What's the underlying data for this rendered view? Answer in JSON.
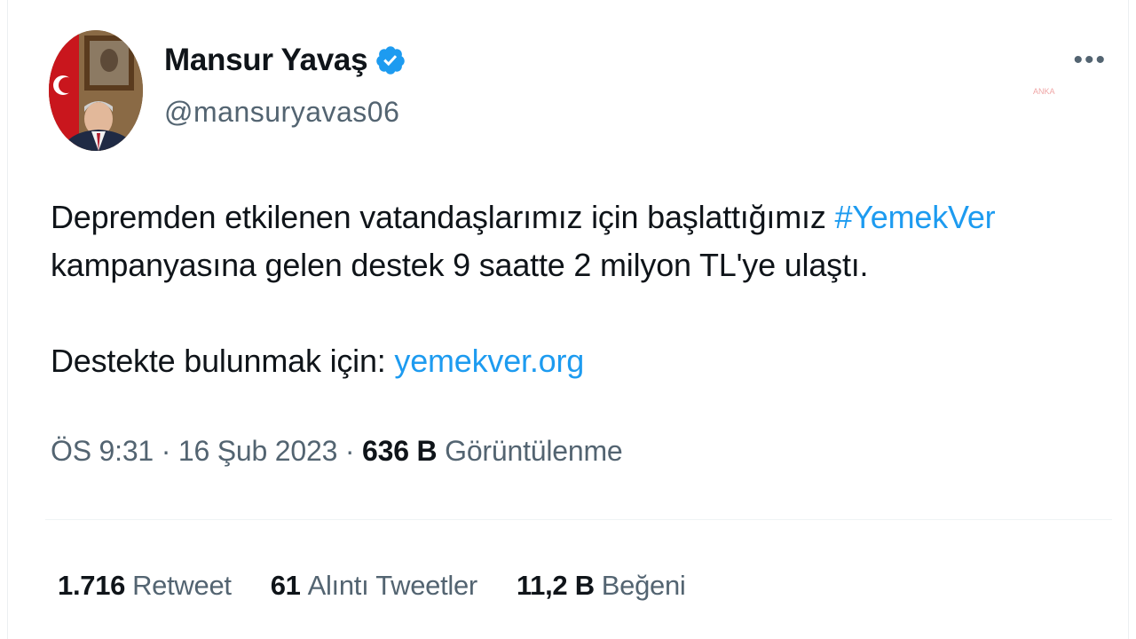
{
  "author": {
    "display_name": "Mansur Yavaş",
    "handle": "@mansuryavas06",
    "verified": true
  },
  "icons": {
    "verified": "verified-badge-icon",
    "more": "more-options-icon"
  },
  "more_label": "•••",
  "tweet": {
    "line1_text": "Depremden etkilenen vatandaşlarımız için başlattığımız ",
    "hashtag": "#YemekVer",
    "line2_text": "kampanyasına gelen destek 9 saatte 2 milyon TL'ye ulaştı.",
    "line3_text": "Destekte bulunmak için: ",
    "url": "yemekver.org"
  },
  "meta": {
    "time": "ÖS 9:31",
    "separator": " · ",
    "date": "16 Şub 2023",
    "views_count": "636 B",
    "views_label": "Görüntülenme"
  },
  "stats": {
    "retweets_count": "1.716",
    "retweets_label": "Retweet",
    "quotes_count": "61",
    "quotes_label": "Alıntı Tweetler",
    "likes_count": "11,2 B",
    "likes_label": "Beğeni"
  },
  "colors": {
    "link": "#1d9bf0",
    "text": "#0f1419",
    "secondary": "#536471"
  }
}
